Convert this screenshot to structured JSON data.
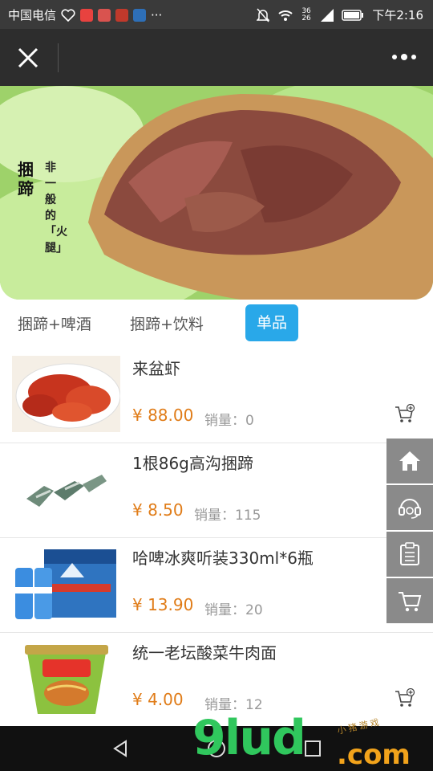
{
  "status_bar": {
    "carrier": "中国电信",
    "time": "下午2:16",
    "network": "36 26"
  },
  "banner": {
    "vertical_title": "捆蹄",
    "slogan": "非一般的「火腿」"
  },
  "tabs": [
    {
      "label": "捆蹄+啤酒",
      "active": false
    },
    {
      "label": "捆蹄+饮料",
      "active": false
    },
    {
      "label": "单品",
      "active": true
    }
  ],
  "sales_prefix": "销量：",
  "products": [
    {
      "name": "来盆虾",
      "price": "¥ 88.00",
      "sales": "0"
    },
    {
      "name": "1根86g高沟捆蹄",
      "price": "¥ 8.50",
      "sales": "115"
    },
    {
      "name": "哈啤冰爽听装330ml*6瓶",
      "price": "¥ 13.90",
      "sales": "20"
    },
    {
      "name": "统一老坛酸菜牛肉面",
      "price": "¥ 4.00",
      "sales": "12"
    }
  ],
  "float_nav": [
    "home-icon",
    "headset-icon",
    "clipboard-icon",
    "cart-icon"
  ],
  "colors": {
    "accent": "#29a8e9",
    "price": "#e07c18",
    "titlebar": "#2d2d2d"
  },
  "watermark": {
    "main": "9lud",
    "domain": ".com",
    "small": "小猪游戏"
  }
}
